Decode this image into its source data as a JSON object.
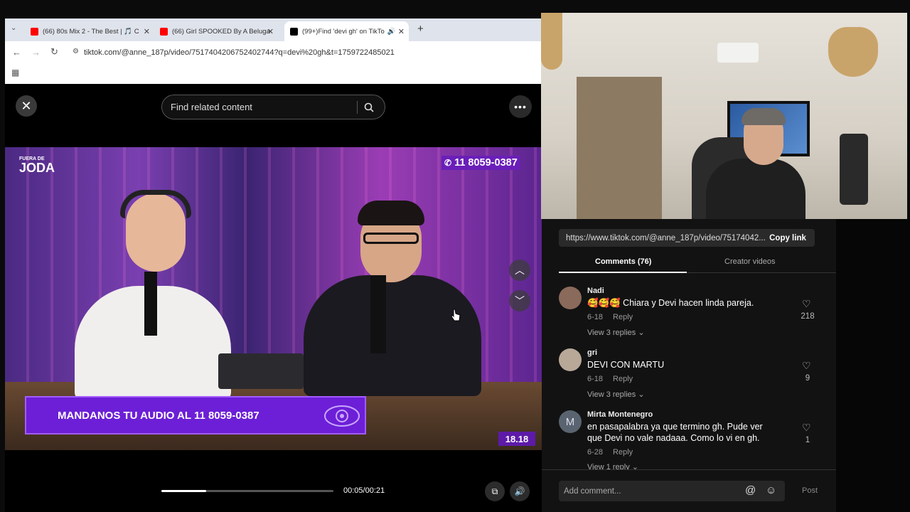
{
  "browser": {
    "tabs": [
      {
        "title": "(66) 80s Mix 2 - The Best | 🎵 C",
        "favicon_color": "#ff0000"
      },
      {
        "title": "(66) Girl SPOOKED By A Beluga",
        "favicon_color": "#ff0000"
      },
      {
        "title": "(99+)Find 'devi gh' on TikTo",
        "favicon_color": "#000000",
        "active": true
      }
    ],
    "new_tab": "+",
    "url": "tiktok.com/@anne_187p/video/7517404206752402744?q=devi%20gh&t=1759722485021"
  },
  "player": {
    "close_icon": "✕",
    "search_placeholder": "Find related content",
    "more_icon": "•••",
    "video": {
      "logo_top": "FUERA DE",
      "logo_main": "JODA",
      "phone": "11 8059-0387",
      "banner": "MANDANOS TU AUDIO AL 11 8059-0387",
      "clock": "18.18"
    },
    "time": "00:05/00:21",
    "progress": 0.26
  },
  "panel": {
    "share_link": "https://www.tiktok.com/@anne_187p/video/75174042...",
    "copy_link": "Copy link",
    "tabs": {
      "comments": "Comments (76)",
      "creator": "Creator videos"
    },
    "comments": [
      {
        "name": "Nadi",
        "text": "🥰🥰🥰 Chiara y Devi hacen linda pareja.",
        "date": "6-18",
        "reply": "Reply",
        "view_replies": "View 3 replies",
        "likes": "218",
        "avatar_color": "#8a6a5a"
      },
      {
        "name": "gri",
        "text": "DEVI CON MARTU",
        "date": "6-18",
        "reply": "Reply",
        "view_replies": "View 3 replies",
        "likes": "9",
        "avatar_color": "#b8a898"
      },
      {
        "name": "Mirta Montenegro",
        "text": "en pasapalabra ya que termino gh. Pude ver que Devi no vale nadaaa. Como lo vi en gh.",
        "date": "6-28",
        "reply": "Reply",
        "view_replies": "View 1 reply",
        "likes": "1",
        "avatar_letter": "M",
        "avatar_color": "#5a6470"
      }
    ],
    "add_comment": "Add comment...",
    "post": "Post"
  }
}
